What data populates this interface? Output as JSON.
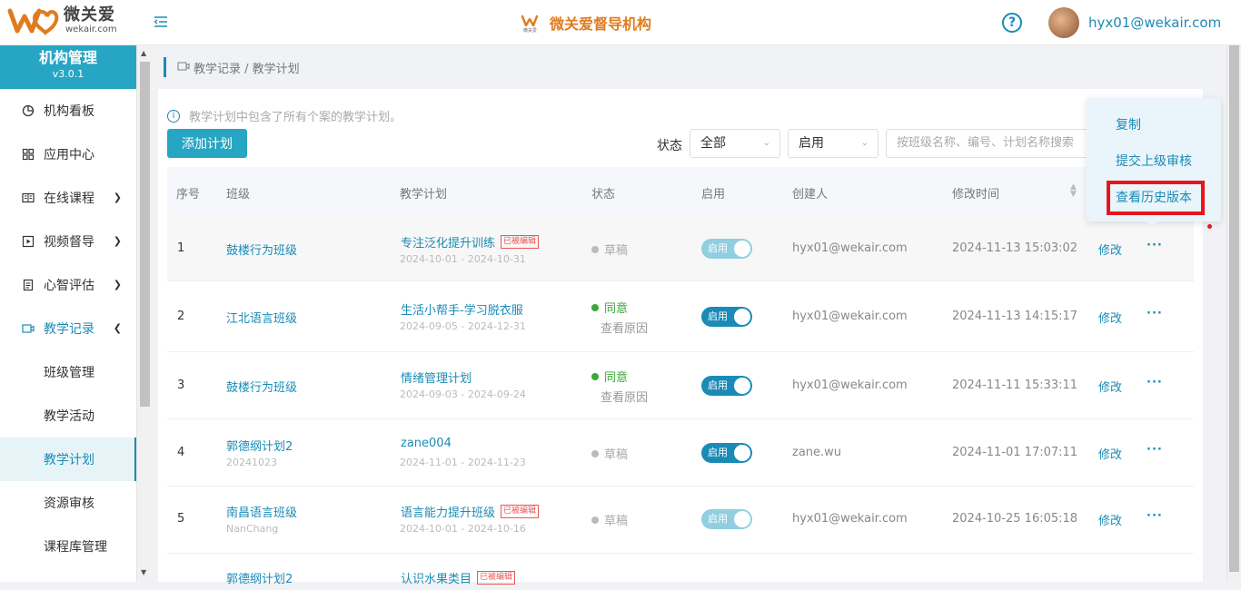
{
  "header": {
    "logo_cn": "微关爱",
    "logo_en": "wekair.com",
    "center_title": "微关爱督导机构",
    "user_email": "hyx01@wekair.com"
  },
  "sidebar": {
    "title": "机构管理",
    "version": "v3.0.1",
    "items": [
      {
        "label": "机构看板",
        "icon": "chart-pie-icon"
      },
      {
        "label": "应用中心",
        "icon": "grid-icon"
      },
      {
        "label": "在线课程",
        "icon": "book-icon"
      },
      {
        "label": "视频督导",
        "icon": "video-play-icon"
      },
      {
        "label": "心智评估",
        "icon": "clipboard-icon"
      },
      {
        "label": "教学记录",
        "icon": "camera-icon"
      }
    ],
    "sub_items": [
      "班级管理",
      "教学活动",
      "教学计划",
      "资源审核",
      "课程库管理"
    ]
  },
  "breadcrumb": "教学记录 / 教学计划",
  "info_text": "教学计划中包含了所有个案的教学计划。",
  "toolbar": {
    "add_label": "添加计划",
    "status_label": "状态",
    "status_value": "全部",
    "enable_value": "启用",
    "search_placeholder": "按班级名称、编号、计划名称搜索"
  },
  "table": {
    "headers": [
      "序号",
      "班级",
      "教学计划",
      "状态",
      "启用",
      "创建人",
      "修改时间"
    ],
    "rows": [
      {
        "idx": "1",
        "cls": "鼓楼行为班级",
        "cls_sub": "",
        "plan": "专注泛化提升训练",
        "edited": "已被编辑",
        "date": "2024-10-01 - 2024-10-31",
        "status": "草稿",
        "reason": "",
        "toggle": "启用",
        "creator": "hyx01@wekair.com",
        "mtime": "2024-11-13 15:03:02",
        "edit": "修改"
      },
      {
        "idx": "2",
        "cls": "江北语言班级",
        "cls_sub": "",
        "plan": "生活小帮手-学习脱衣服",
        "edited": "",
        "date": "2024-09-05 - 2024-12-31",
        "status": "同意",
        "reason": "查看原因",
        "toggle": "启用",
        "creator": "hyx01@wekair.com",
        "mtime": "2024-11-13 14:15:17",
        "edit": "修改"
      },
      {
        "idx": "3",
        "cls": "鼓楼行为班级",
        "cls_sub": "",
        "plan": "情绪管理计划",
        "edited": "",
        "date": "2024-09-03 - 2024-09-24",
        "status": "同意",
        "reason": "查看原因",
        "toggle": "启用",
        "creator": "hyx01@wekair.com",
        "mtime": "2024-11-11 15:33:11",
        "edit": "修改"
      },
      {
        "idx": "4",
        "cls": "郭德纲计划2",
        "cls_sub": "20241023",
        "plan": "zane004",
        "edited": "",
        "date": "2024-11-01 - 2024-11-23",
        "status": "草稿",
        "reason": "",
        "toggle": "启用",
        "creator": "zane.wu",
        "mtime": "2024-11-01 17:07:11",
        "edit": "修改"
      },
      {
        "idx": "5",
        "cls": "南昌语言班级",
        "cls_sub": "NanChang",
        "plan": "语言能力提升班级",
        "edited": "已被编辑",
        "date": "2024-10-01 - 2024-10-16",
        "status": "草稿",
        "reason": "",
        "toggle": "启用",
        "creator": "hyx01@wekair.com",
        "mtime": "2024-10-25 16:05:18",
        "edit": "修改"
      },
      {
        "idx": "",
        "cls": "郭德纲计划2",
        "cls_sub": "",
        "plan": "认识水果类目",
        "edited": "已被编辑",
        "date": "",
        "status": "",
        "reason": "",
        "toggle": "",
        "creator": "",
        "mtime": "",
        "edit": ""
      }
    ]
  },
  "dropdown": {
    "items": [
      "复制",
      "提交上级审核",
      "查看历史版本"
    ]
  },
  "colors": {
    "accent": "#1a8bb6",
    "sidebar_head": "#27a6c4",
    "brand_orange": "#e07b1f",
    "approved": "#3aa73a",
    "highlight": "#e8141a"
  }
}
